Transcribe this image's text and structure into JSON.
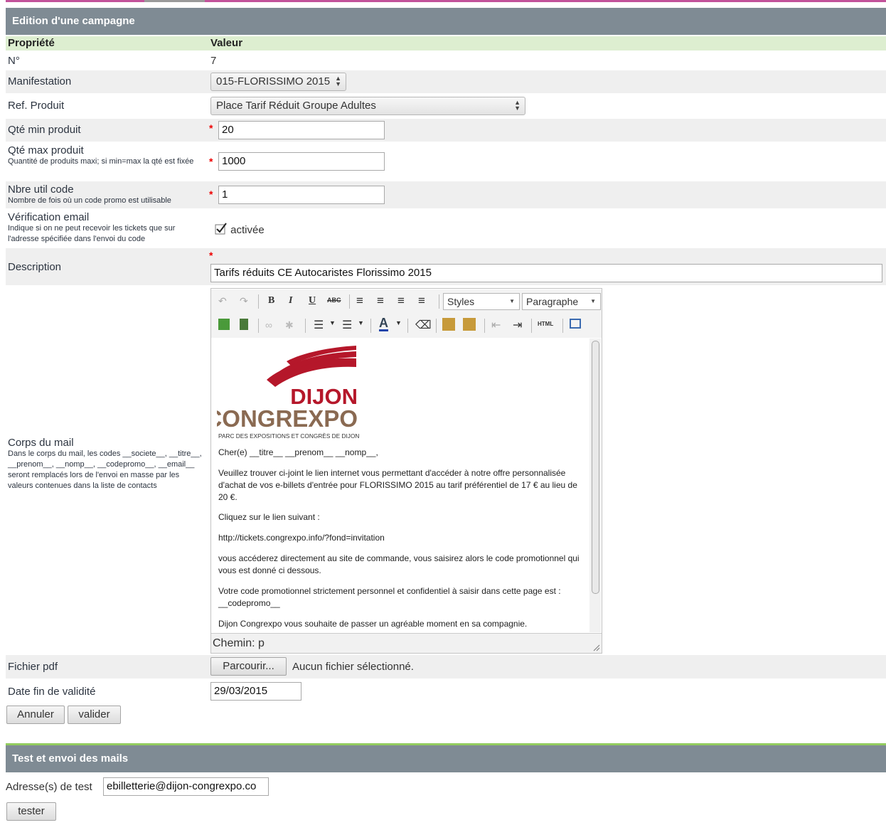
{
  "campaign": {
    "panel_title": "Edition d'une campagne",
    "header_property": "Propriété",
    "header_value": "Valeur",
    "number_label": "N°",
    "number_value": "7",
    "manifestation_label": "Manifestation",
    "manifestation_value": "015-FLORISSIMO 2015",
    "ref_label": "Ref. Produit",
    "ref_value": "Place Tarif Réduit Groupe Adultes",
    "qty_min_label": "Qté min produit",
    "qty_min_value": "20",
    "qty_max_label": "Qté max produit",
    "qty_max_help": "Quantité de produits maxi; si min=max la qté est fixée",
    "qty_max_value": "1000",
    "code_uses_label": "Nbre util code",
    "code_uses_help": "Nombre de fois où un code promo est utilisable",
    "code_uses_value": "1",
    "email_verif_label": "Vérification email",
    "email_verif_help": "Indique si on ne peut recevoir les tickets que sur l'adresse spécifiée dans l'envoi du code",
    "email_verif_checkbox_label": "activée",
    "email_verif_checked": true,
    "description_label": "Description",
    "description_value": "Tarifs réduits CE Autocaristes Florissimo 2015",
    "body_label": "Corps du mail",
    "body_help": "Dans le corps du mail, les codes __societe__, __titre__, __prenom__, __nomp__, __codepromo__, __email__ seront remplacés lors de l'envoi en masse par les valeurs contenues dans la liste de contacts",
    "pdf_label": "Fichier pdf",
    "pdf_button": "Parcourir...",
    "pdf_status": "Aucun fichier sélectionné.",
    "end_date_label": "Date fin de validité",
    "end_date_value": "29/03/2015",
    "cancel_button": "Annuler",
    "submit_button": "valider"
  },
  "editor": {
    "styles_select": "Styles",
    "format_select": "Paragraphe",
    "path": "Chemin: p",
    "logo": {
      "line1": "DIJON",
      "line2": "CONGREXPO",
      "tagline": "PARC DES EXPOSITIONS ET CONGRÈS DE DIJON",
      "color_red": "#b5172a",
      "color_brown": "#8a6a52"
    },
    "paragraphs": [
      "Cher(e) __titre__ __prenom__ __nomp__,",
      "Veuillez trouver ci-joint le lien internet vous permettant d'accéder à notre offre personnalisée d'achat de vos e-billets d'entrée pour FLORISSIMO 2015 au tarif préférentiel de 17 € au lieu de 20 €.",
      "Cliquez sur le lien suivant :",
      "http://tickets.congrexpo.info/?fond=invitation",
      "vous accéderez directement au site de commande, vous saisirez alors le code promotionnel qui vous est donné ci dessous.",
      "Votre code promotionnel strictement personnel et confidentiel à saisir dans cette page est : __codepromo__",
      "Dijon Congrexpo vous souhaite de passer un agréable moment en sa compagnie."
    ]
  },
  "test": {
    "panel_title": "Test et envoi des mails",
    "address_label": "Adresse(s) de test",
    "address_value": "ebilletterie@dijon-congrexpo.co",
    "test_button": "tester"
  },
  "colors": {
    "panel_header": "#7f8b94",
    "top_accent": "#c2529a",
    "bottom_accent": "#93cc5f",
    "table_header": "#ddeed0",
    "alt_row": "#efefef"
  }
}
